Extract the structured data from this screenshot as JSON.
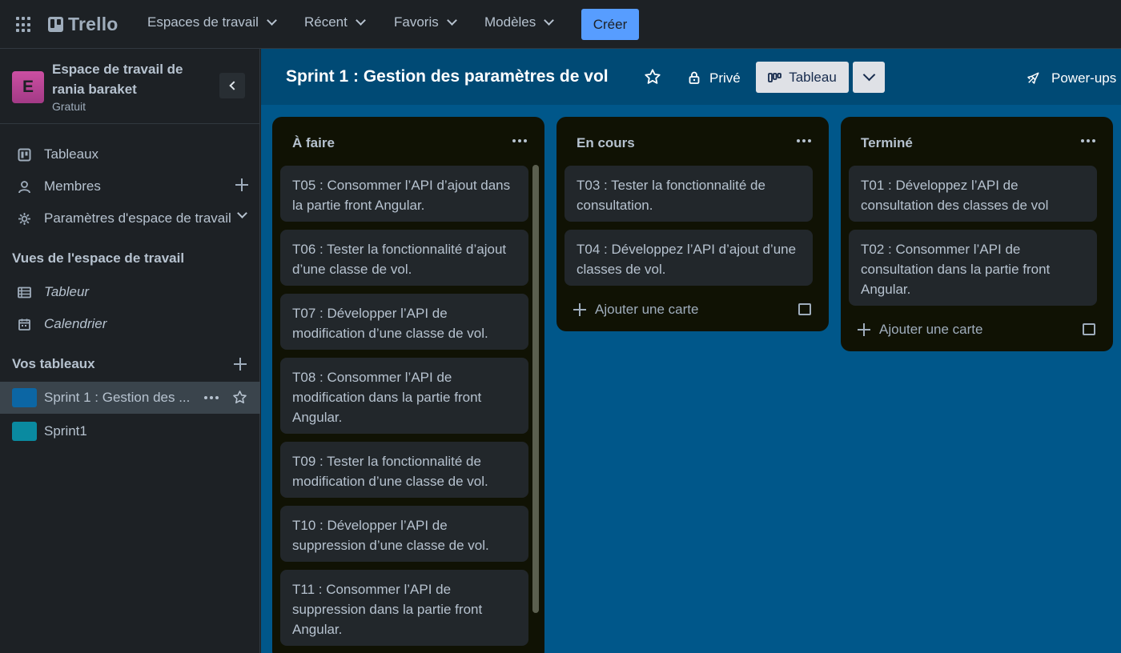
{
  "topbar": {
    "logo": "Trello",
    "nav": [
      "Espaces de travail",
      "Récent",
      "Favoris",
      "Modèles"
    ],
    "create_label": "Créer"
  },
  "sidebar": {
    "workspace_initial": "E",
    "workspace_name": "Espace de travail de rania baraket",
    "workspace_plan": "Gratuit",
    "menu": [
      {
        "label": "Tableaux",
        "icon": "board-icon"
      },
      {
        "label": "Membres",
        "icon": "person-icon"
      },
      {
        "label": "Paramètres d'espace de travail",
        "icon": "gear-icon"
      }
    ],
    "views_title": "Vues de l'espace de travail",
    "views": [
      {
        "label": "Tableur",
        "icon": "table-icon"
      },
      {
        "label": "Calendrier",
        "icon": "calendar-icon"
      }
    ],
    "boards_title": "Vos tableaux",
    "boards": [
      {
        "label": "Sprint 1 : Gestion des ...",
        "color": "#0c66a4"
      },
      {
        "label": "Sprint1",
        "color": "#0a8aa0"
      }
    ]
  },
  "board": {
    "title": "Sprint 1 : Gestion des paramètres de vol",
    "visibility": "Privé",
    "view_label": "Tableau",
    "powerups": "Power-ups",
    "background": "#00578a",
    "lists": [
      {
        "title": "À faire",
        "cards": [
          "T05 : Consommer l’API d’ajout dans la partie front Angular.",
          "T06 : Tester la fonctionnalité d’ajout d’une classe de vol.",
          "T07 : Développer l’API de modification d’une classe de vol.",
          "T08 : Consommer l’API de modification dans la partie front Angular.",
          "T09 : Tester la fonctionnalité de modification d’une classe de vol.",
          "T10 : Développer l’API de suppression d’une classe de vol.",
          "T11 : Consommer l’API de suppression dans la partie front Angular."
        ]
      },
      {
        "title": "En cours",
        "cards": [
          "T03 : Tester la fonctionnalité de consultation.",
          "T04 : Développez l’API d’ajout d’une classes de vol."
        ],
        "add_card": "Ajouter une carte"
      },
      {
        "title": "Terminé",
        "cards": [
          "T01 : Développez l’API de consultation des classes de vol",
          "T02 : Consommer l’API de consultation dans la partie front Angular."
        ],
        "add_card": "Ajouter une carte"
      }
    ]
  }
}
